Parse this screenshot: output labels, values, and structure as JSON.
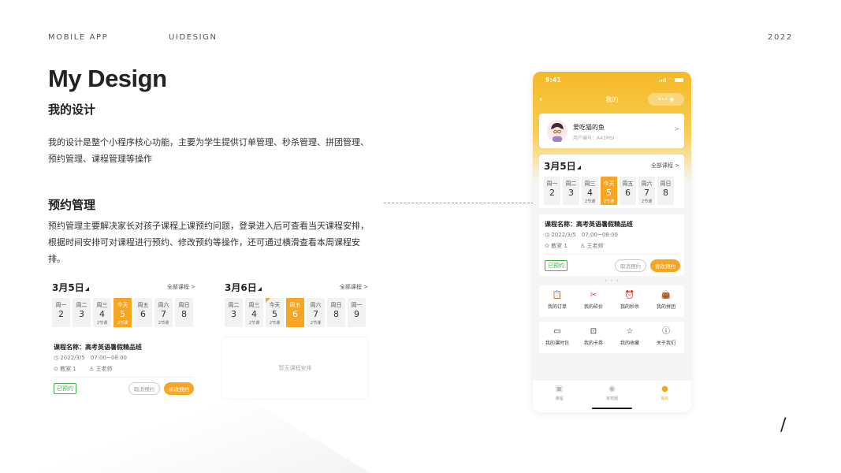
{
  "header": {
    "app": "MOBILE APP",
    "ui": "UIDESIGN",
    "year": "2022"
  },
  "title": {
    "en": "My Design",
    "cn": "我的设计"
  },
  "intro": {
    "line1": "我的设计是整个小程序核心功能，主要为学生提供订单管理、秒杀管理、拼团管理、",
    "line2": "预约管理、课程管理等操作"
  },
  "section": {
    "title": "预约管理",
    "line1": "预约管理主要解决家长对孩子课程上课预约问题，登录进入后可查看当天课程安排，",
    "line2": "根据时间安排可对课程进行预约、修改预约等操作，还可通过横滑查看本周课程安",
    "line3": "排。"
  },
  "slash": "/",
  "schedule_a": {
    "date": "3月5日",
    "all_courses": "全部课程 >",
    "days": [
      {
        "wk": "周一",
        "num": "2",
        "cls": ""
      },
      {
        "wk": "周二",
        "num": "3",
        "cls": ""
      },
      {
        "wk": "周三",
        "num": "4",
        "cls": "2节课"
      },
      {
        "wk": "今天",
        "num": "5",
        "cls": "2节课"
      },
      {
        "wk": "周五",
        "num": "6",
        "cls": ""
      },
      {
        "wk": "周六",
        "num": "7",
        "cls": "2节课"
      },
      {
        "wk": "周日",
        "num": "8",
        "cls": ""
      }
    ]
  },
  "schedule_b": {
    "date": "3月6日",
    "all_courses": "全部课程 >",
    "days": [
      {
        "wk": "周二",
        "num": "3",
        "cls": ""
      },
      {
        "wk": "周三",
        "num": "4",
        "cls": "2节课"
      },
      {
        "wk": "今天",
        "num": "5",
        "cls": "2节课"
      },
      {
        "wk": "周五",
        "num": "6",
        "cls": ""
      },
      {
        "wk": "周六",
        "num": "7",
        "cls": "2节课"
      },
      {
        "wk": "周日",
        "num": "8",
        "cls": ""
      },
      {
        "wk": "周一",
        "num": "9",
        "cls": ""
      }
    ],
    "empty": "暂无课程安排"
  },
  "course": {
    "title": "课程名称：高考英语暑假精品班",
    "time": "2022/3/5　07:00~08:00",
    "room": "教室 1",
    "teacher": "王老师",
    "status": "已预约",
    "cancel": "取消预约",
    "edit": "修改预约"
  },
  "phone": {
    "time": "9:41",
    "nav_title": "我的",
    "back": "‹",
    "capsule": "•••  ◉",
    "user": {
      "name": "爱吃猫的鱼",
      "id": "用户编号：A43MSI",
      "arrow": ">"
    },
    "dots": "• • •",
    "menu1": [
      {
        "icon": "📋",
        "label": "我的订单",
        "icon_name": "order-icon"
      },
      {
        "icon": "✂",
        "label": "我的砍价",
        "icon_name": "bargain-icon"
      },
      {
        "icon": "⏰",
        "label": "我的秒杀",
        "icon_name": "flash-sale-icon"
      },
      {
        "icon": "👜",
        "label": "我的拼团",
        "icon_name": "group-buy-icon"
      }
    ],
    "menu2": [
      {
        "icon": "▭",
        "label": "我的课时包",
        "icon_name": "lesson-pack-icon"
      },
      {
        "icon": "⊡",
        "label": "我的卡券",
        "icon_name": "coupon-icon"
      },
      {
        "icon": "☆",
        "label": "我的收藏",
        "icon_name": "favorite-icon"
      },
      {
        "icon": "ⓘ",
        "label": "关于我们",
        "icon_name": "about-icon"
      }
    ],
    "tabs": [
      {
        "icon": "▣",
        "label": "课程"
      },
      {
        "icon": "◉",
        "label": "家校圈"
      },
      {
        "icon": "●",
        "label": "我的"
      }
    ]
  },
  "colors": {
    "accent": "#f6a623",
    "success": "#3fae4a",
    "header_gradient_top": "#f6b827"
  }
}
